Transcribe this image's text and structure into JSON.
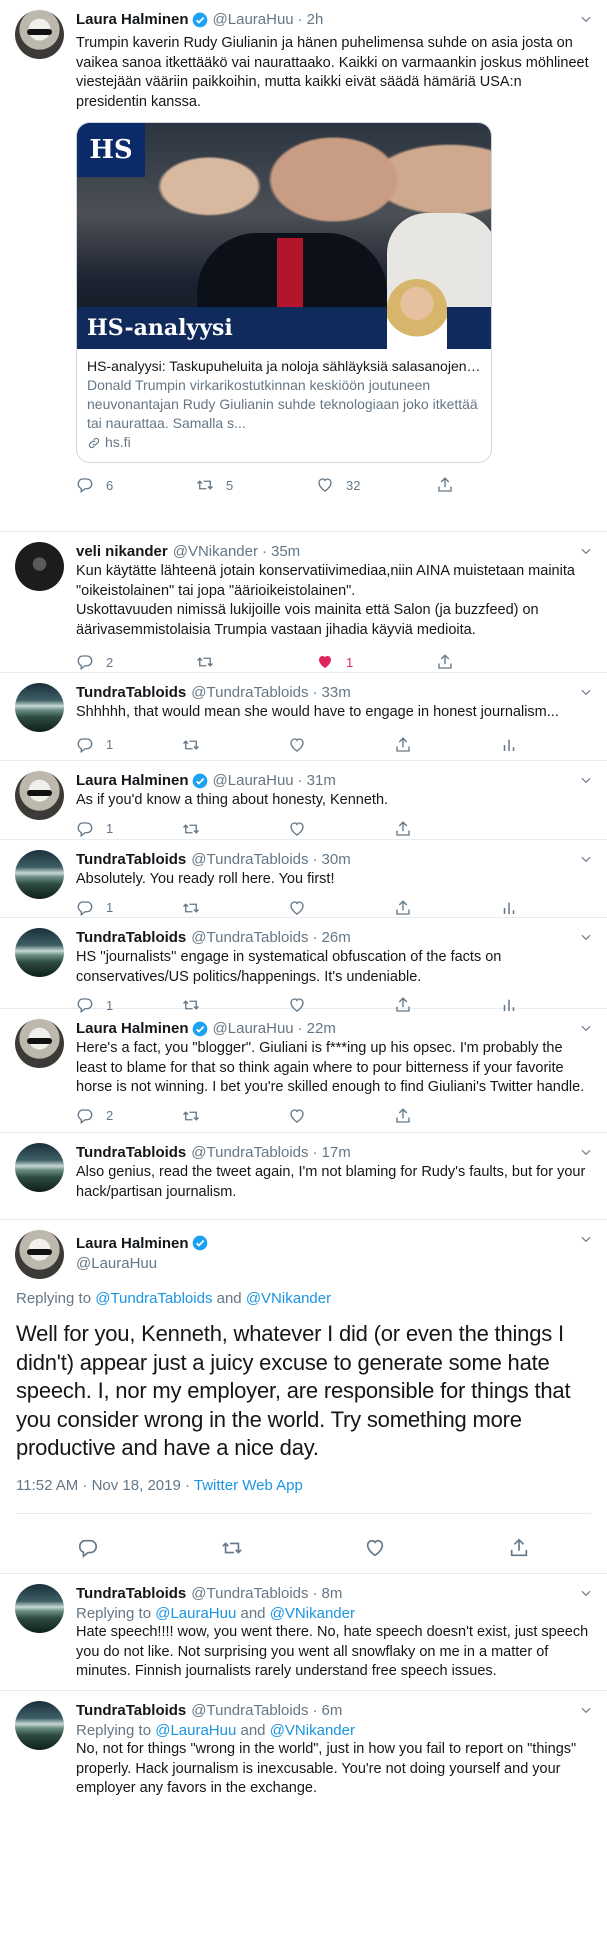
{
  "tweets": [
    {
      "name": "Laura Halminen",
      "handle": "@LauraHuu",
      "time": "2h",
      "text": "Trumpin kaverin Rudy Giulianin ja hänen puhelimensa suhde on asia josta on vaikea sanoa itkettääkö vai naurattaako. Kaikki on varmaankin joskus möhlineet viestejään vääriin paikkoihin, mutta kaikki eivät säädä hämäriä USA:n presidentin kanssa.",
      "replies": "6",
      "retweets": "5",
      "likes": "32",
      "card": {
        "logo": "HS",
        "band_title": "HS-analyysi",
        "title": "HS-analyysi: Taskupuheluita ja noloja sähläyksiä salasanojen kanssa: Tru...",
        "description": "Donald Trumpin virkarikostutkinnan keskiöön joutuneen neuvonantajan Rudy Giulianin suhde teknologiaan joko itkettää tai naurattaa. Samalla s...",
        "domain": "hs.fi"
      }
    },
    {
      "name": "veli nikander",
      "handle": "@VNikander",
      "time": "35m",
      "text": "Kun käytätte lähteenä jotain konservatiivimediaa,niin AINA muistetaan mainita \"oikeistolainen\" tai jopa \"äärioikeistolainen\".\nUskottavuuden nimissä lukijoille vois mainita että Salon (ja buzzfeed) on äärivasemmistolaisia Trumpia vastaan jihadia käyviä medioita.",
      "replies": "2",
      "retweets": "",
      "likes": "1"
    },
    {
      "name": "TundraTabloids",
      "handle": "@TundraTabloids",
      "time": "33m",
      "text": "Shhhhh, that would mean she would have to engage in honest journalism...",
      "replies": "1",
      "retweets": "",
      "likes": ""
    },
    {
      "name": "Laura Halminen",
      "handle": "@LauraHuu",
      "time": "31m",
      "text": "As if you'd know a thing about honesty, Kenneth.",
      "replies": "1",
      "retweets": "",
      "likes": ""
    },
    {
      "name": "TundraTabloids",
      "handle": "@TundraTabloids",
      "time": "30m",
      "text": "Absolutely. You ready roll here. You first!",
      "replies": "1",
      "retweets": "",
      "likes": ""
    },
    {
      "name": "TundraTabloids",
      "handle": "@TundraTabloids",
      "time": "26m",
      "text": "HS ''journalists'' engage in systematical obfuscation of the facts on conservatives/US politics/happenings. It's undeniable.",
      "replies": "1",
      "retweets": "",
      "likes": ""
    },
    {
      "name": "Laura Halminen",
      "handle": "@LauraHuu",
      "time": "22m",
      "text": "Here's a fact, you \"blogger\". Giuliani is f***ing up his opsec. I'm probably the least to blame for that so think again where to pour bitterness if your favorite horse is not winning. I bet you're skilled enough to find Giuliani's Twitter handle.",
      "replies": "2",
      "retweets": "",
      "likes": ""
    },
    {
      "name": "TundraTabloids",
      "handle": "@TundraTabloids",
      "time": "17m",
      "text": "Also genius, read the tweet again, I'm not blaming for Rudy's faults, but for your hack/partisan journalism.",
      "replies": "",
      "retweets": "",
      "likes": ""
    }
  ],
  "focal": {
    "name": "Laura Halminen",
    "handle": "@LauraHuu",
    "replying_prefix": "Replying to ",
    "replying_user1": "@TundraTabloids",
    "replying_and": " and ",
    "replying_user2": "@VNikander",
    "text": "Well for you, Kenneth, whatever I did (or even the things I didn't) appear just a juicy excuse to generate some hate speech. I, nor my employer, are responsible for things that you consider wrong in the world. Try something more productive and have a nice day.",
    "timestamp": "11:52 AM · Nov 18, 2019 · ",
    "source": "Twitter Web App"
  },
  "replies": [
    {
      "name": "TundraTabloids",
      "handle": "@TundraTabloids",
      "time": "8m",
      "replying_prefix": "Replying to ",
      "replying_user1": "@LauraHuu",
      "replying_and": " and ",
      "replying_user2": "@VNikander",
      "text": "Hate speech!!!!  wow, you went there. No, hate speech doesn't exist, just speech you do not like. Not surprising you went all snowflaky on me in a matter of minutes. Finnish journalists rarely understand free speech issues."
    },
    {
      "name": "TundraTabloids",
      "handle": "@TundraTabloids",
      "time": "6m",
      "replying_prefix": "Replying to ",
      "replying_user1": "@LauraHuu",
      "replying_and": " and ",
      "replying_user2": "@VNikander",
      "text": "No, not for things \"wrong in the world\", just in how you fail to report on \"things\" properly. Hack journalism is inexcusable. You're not doing yourself and your employer any favors in the exchange."
    }
  ],
  "icons": {
    "reply": "reply-icon",
    "retweet": "retweet-icon",
    "like": "heart-icon",
    "share": "share-icon",
    "analytics": "analytics-icon",
    "verified": "verified-badge-icon",
    "caret": "chevron-down-icon",
    "link": "link-icon"
  },
  "colors": {
    "text": "#14171a",
    "secondary": "#657786",
    "link": "#1b95e0",
    "like": "#e0245e",
    "border": "#e6ecf0"
  }
}
